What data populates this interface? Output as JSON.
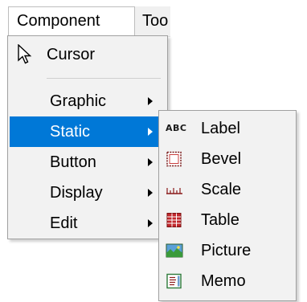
{
  "menubar": {
    "items": [
      {
        "label": "Component"
      },
      {
        "label": "Too"
      }
    ]
  },
  "menu": {
    "items": [
      {
        "label": "Cursor",
        "icon": "cursor-arrow-icon"
      },
      {
        "label": "Graphic",
        "has_submenu": true
      },
      {
        "label": "Static",
        "has_submenu": true,
        "active": true
      },
      {
        "label": "Button",
        "has_submenu": true
      },
      {
        "label": "Display",
        "has_submenu": true
      },
      {
        "label": "Edit",
        "has_submenu": true
      }
    ]
  },
  "submenu": {
    "items": [
      {
        "label": "Label",
        "icon": "abc-label-icon",
        "icon_text": "ABC"
      },
      {
        "label": "Bevel",
        "icon": "bevel-icon"
      },
      {
        "label": "Scale",
        "icon": "scale-icon"
      },
      {
        "label": "Table",
        "icon": "table-icon"
      },
      {
        "label": "Picture",
        "icon": "picture-icon"
      },
      {
        "label": "Memo",
        "icon": "memo-icon"
      }
    ]
  },
  "colors": {
    "highlight": "#0078d7",
    "menu_background": "#f2f2f2",
    "menu_border": "#a0a0a0",
    "table_icon_red": "#c0282d",
    "picture_icon_green": "#3a9a3a"
  }
}
